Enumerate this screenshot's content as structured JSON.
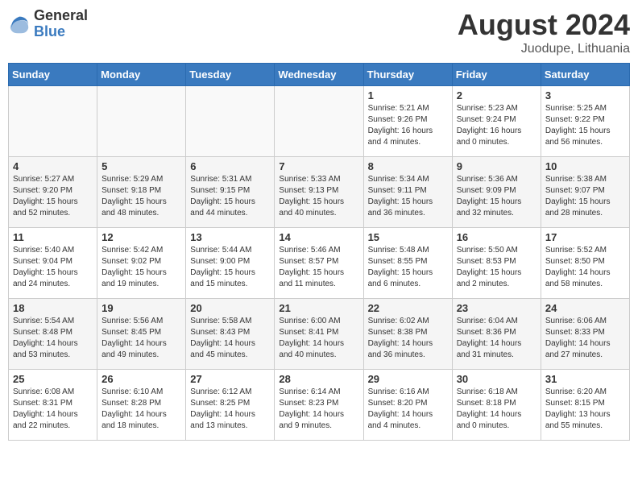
{
  "header": {
    "logo_general": "General",
    "logo_blue": "Blue",
    "title": "August 2024",
    "location": "Juodupe, Lithuania"
  },
  "days_of_week": [
    "Sunday",
    "Monday",
    "Tuesday",
    "Wednesday",
    "Thursday",
    "Friday",
    "Saturday"
  ],
  "weeks": [
    [
      {
        "day": "",
        "info": ""
      },
      {
        "day": "",
        "info": ""
      },
      {
        "day": "",
        "info": ""
      },
      {
        "day": "",
        "info": ""
      },
      {
        "day": "1",
        "info": "Sunrise: 5:21 AM\nSunset: 9:26 PM\nDaylight: 16 hours\nand 4 minutes."
      },
      {
        "day": "2",
        "info": "Sunrise: 5:23 AM\nSunset: 9:24 PM\nDaylight: 16 hours\nand 0 minutes."
      },
      {
        "day": "3",
        "info": "Sunrise: 5:25 AM\nSunset: 9:22 PM\nDaylight: 15 hours\nand 56 minutes."
      }
    ],
    [
      {
        "day": "4",
        "info": "Sunrise: 5:27 AM\nSunset: 9:20 PM\nDaylight: 15 hours\nand 52 minutes."
      },
      {
        "day": "5",
        "info": "Sunrise: 5:29 AM\nSunset: 9:18 PM\nDaylight: 15 hours\nand 48 minutes."
      },
      {
        "day": "6",
        "info": "Sunrise: 5:31 AM\nSunset: 9:15 PM\nDaylight: 15 hours\nand 44 minutes."
      },
      {
        "day": "7",
        "info": "Sunrise: 5:33 AM\nSunset: 9:13 PM\nDaylight: 15 hours\nand 40 minutes."
      },
      {
        "day": "8",
        "info": "Sunrise: 5:34 AM\nSunset: 9:11 PM\nDaylight: 15 hours\nand 36 minutes."
      },
      {
        "day": "9",
        "info": "Sunrise: 5:36 AM\nSunset: 9:09 PM\nDaylight: 15 hours\nand 32 minutes."
      },
      {
        "day": "10",
        "info": "Sunrise: 5:38 AM\nSunset: 9:07 PM\nDaylight: 15 hours\nand 28 minutes."
      }
    ],
    [
      {
        "day": "11",
        "info": "Sunrise: 5:40 AM\nSunset: 9:04 PM\nDaylight: 15 hours\nand 24 minutes."
      },
      {
        "day": "12",
        "info": "Sunrise: 5:42 AM\nSunset: 9:02 PM\nDaylight: 15 hours\nand 19 minutes."
      },
      {
        "day": "13",
        "info": "Sunrise: 5:44 AM\nSunset: 9:00 PM\nDaylight: 15 hours\nand 15 minutes."
      },
      {
        "day": "14",
        "info": "Sunrise: 5:46 AM\nSunset: 8:57 PM\nDaylight: 15 hours\nand 11 minutes."
      },
      {
        "day": "15",
        "info": "Sunrise: 5:48 AM\nSunset: 8:55 PM\nDaylight: 15 hours\nand 6 minutes."
      },
      {
        "day": "16",
        "info": "Sunrise: 5:50 AM\nSunset: 8:53 PM\nDaylight: 15 hours\nand 2 minutes."
      },
      {
        "day": "17",
        "info": "Sunrise: 5:52 AM\nSunset: 8:50 PM\nDaylight: 14 hours\nand 58 minutes."
      }
    ],
    [
      {
        "day": "18",
        "info": "Sunrise: 5:54 AM\nSunset: 8:48 PM\nDaylight: 14 hours\nand 53 minutes."
      },
      {
        "day": "19",
        "info": "Sunrise: 5:56 AM\nSunset: 8:45 PM\nDaylight: 14 hours\nand 49 minutes."
      },
      {
        "day": "20",
        "info": "Sunrise: 5:58 AM\nSunset: 8:43 PM\nDaylight: 14 hours\nand 45 minutes."
      },
      {
        "day": "21",
        "info": "Sunrise: 6:00 AM\nSunset: 8:41 PM\nDaylight: 14 hours\nand 40 minutes."
      },
      {
        "day": "22",
        "info": "Sunrise: 6:02 AM\nSunset: 8:38 PM\nDaylight: 14 hours\nand 36 minutes."
      },
      {
        "day": "23",
        "info": "Sunrise: 6:04 AM\nSunset: 8:36 PM\nDaylight: 14 hours\nand 31 minutes."
      },
      {
        "day": "24",
        "info": "Sunrise: 6:06 AM\nSunset: 8:33 PM\nDaylight: 14 hours\nand 27 minutes."
      }
    ],
    [
      {
        "day": "25",
        "info": "Sunrise: 6:08 AM\nSunset: 8:31 PM\nDaylight: 14 hours\nand 22 minutes."
      },
      {
        "day": "26",
        "info": "Sunrise: 6:10 AM\nSunset: 8:28 PM\nDaylight: 14 hours\nand 18 minutes."
      },
      {
        "day": "27",
        "info": "Sunrise: 6:12 AM\nSunset: 8:25 PM\nDaylight: 14 hours\nand 13 minutes."
      },
      {
        "day": "28",
        "info": "Sunrise: 6:14 AM\nSunset: 8:23 PM\nDaylight: 14 hours\nand 9 minutes."
      },
      {
        "day": "29",
        "info": "Sunrise: 6:16 AM\nSunset: 8:20 PM\nDaylight: 14 hours\nand 4 minutes."
      },
      {
        "day": "30",
        "info": "Sunrise: 6:18 AM\nSunset: 8:18 PM\nDaylight: 14 hours\nand 0 minutes."
      },
      {
        "day": "31",
        "info": "Sunrise: 6:20 AM\nSunset: 8:15 PM\nDaylight: 13 hours\nand 55 minutes."
      }
    ]
  ]
}
